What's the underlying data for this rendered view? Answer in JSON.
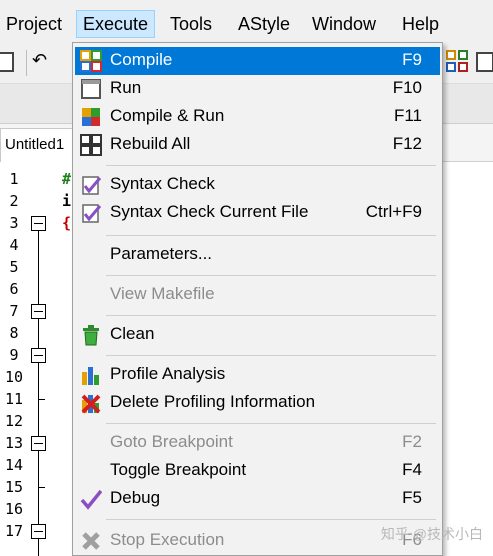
{
  "menubar": {
    "items": [
      "Project",
      "Execute",
      "Tools",
      "AStyle",
      "Window",
      "Help"
    ]
  },
  "editor": {
    "tab_label": "Untitled1",
    "line_numbers": [
      "1",
      "2",
      "3",
      "4",
      "5",
      "6",
      "7",
      "8",
      "9",
      "10",
      "11",
      "12",
      "13",
      "14",
      "15",
      "16",
      "17"
    ],
    "code_fragments": [
      "#",
      "i",
      "{"
    ]
  },
  "execute_menu": {
    "items": [
      {
        "label": "Compile",
        "shortcut": "F9",
        "icon": "compile-icon",
        "state": "highlighted"
      },
      {
        "label": "Run",
        "shortcut": "F10",
        "icon": "run-icon",
        "state": "normal"
      },
      {
        "label": "Compile & Run",
        "shortcut": "F11",
        "icon": "compile-run-icon",
        "state": "normal"
      },
      {
        "label": "Rebuild All",
        "shortcut": "F12",
        "icon": "rebuild-icon",
        "state": "normal"
      },
      {
        "label": "Syntax Check",
        "shortcut": "",
        "icon": "syntax-check-icon",
        "state": "normal"
      },
      {
        "label": "Syntax Check Current File",
        "shortcut": "Ctrl+F9",
        "icon": "syntax-check-file-icon",
        "state": "normal"
      },
      {
        "label": "Parameters...",
        "shortcut": "",
        "icon": "",
        "state": "normal"
      },
      {
        "label": "View Makefile",
        "shortcut": "",
        "icon": "",
        "state": "disabled"
      },
      {
        "label": "Clean",
        "shortcut": "",
        "icon": "trash-icon",
        "state": "normal"
      },
      {
        "label": "Profile Analysis",
        "shortcut": "",
        "icon": "bar-chart-icon",
        "state": "normal"
      },
      {
        "label": "Delete Profiling Information",
        "shortcut": "",
        "icon": "delete-chart-icon",
        "state": "normal"
      },
      {
        "label": "Goto Breakpoint",
        "shortcut": "F2",
        "icon": "",
        "state": "disabled"
      },
      {
        "label": "Toggle Breakpoint",
        "shortcut": "F4",
        "icon": "",
        "state": "normal"
      },
      {
        "label": "Debug",
        "shortcut": "F5",
        "icon": "check-icon",
        "state": "normal"
      },
      {
        "label": "Stop Execution",
        "shortcut": "F6",
        "icon": "stop-icon",
        "state": "disabled"
      }
    ]
  },
  "watermark": "知乎 @技术小白",
  "colors": {
    "highlight": "#0078d7",
    "menu_bg": "#f2f2f2",
    "disabled_text": "#8c8c8c"
  }
}
